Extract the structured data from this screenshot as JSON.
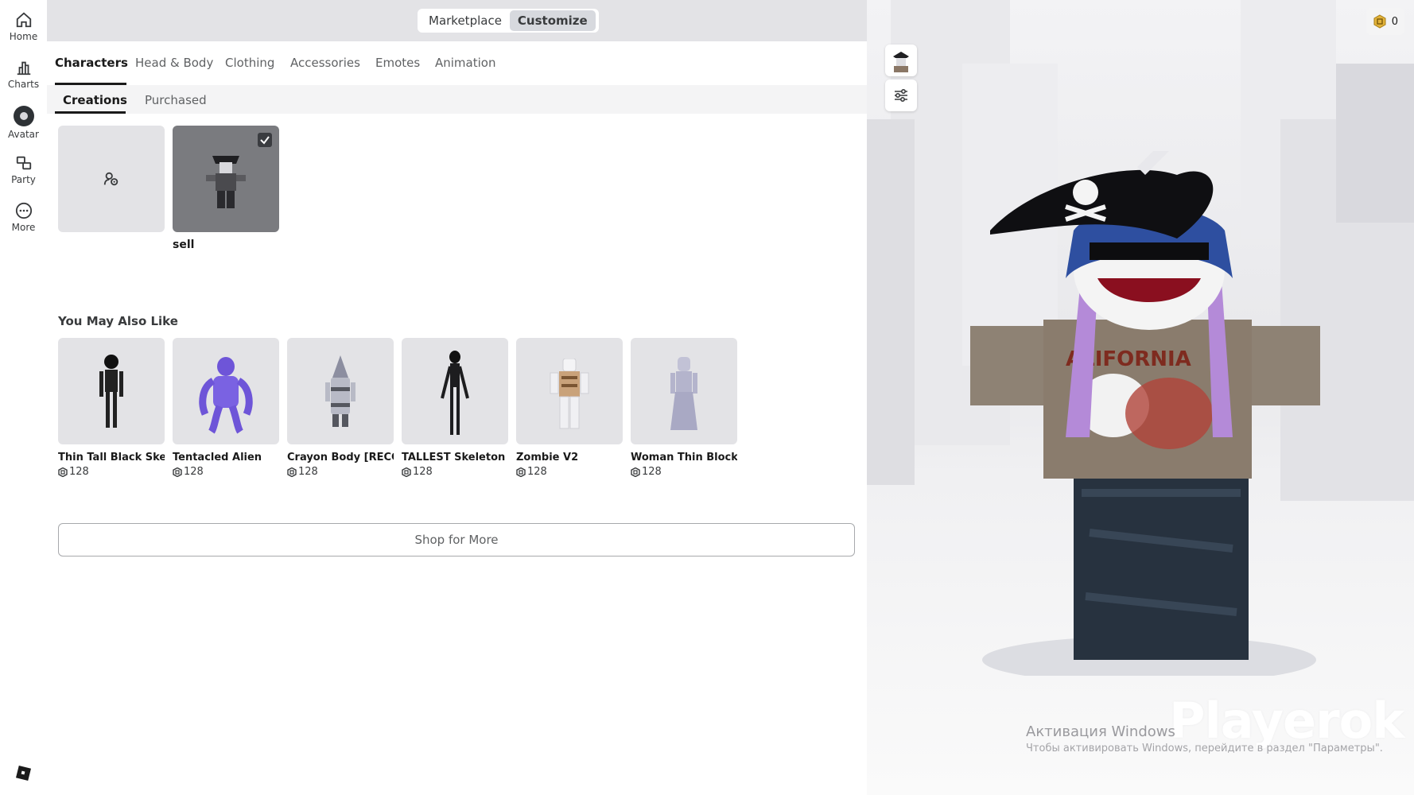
{
  "nav": {
    "items": [
      {
        "label": "Home",
        "icon": "home-icon"
      },
      {
        "label": "Charts",
        "icon": "charts-icon"
      },
      {
        "label": "Avatar",
        "icon": "avatar-icon"
      },
      {
        "label": "Party",
        "icon": "party-icon"
      },
      {
        "label": "More",
        "icon": "more-icon"
      }
    ]
  },
  "topbar": {
    "marketplace": "Marketplace",
    "customize": "Customize"
  },
  "tabs": [
    "Characters",
    "Head & Body",
    "Clothing",
    "Accessories",
    "Emotes",
    "Animation"
  ],
  "subtabs": [
    "Creations",
    "Purchased"
  ],
  "creations": [
    {
      "label": "",
      "type": "create-new"
    },
    {
      "label": "sell",
      "selected": true
    }
  ],
  "recommend": {
    "title": "You May Also Like",
    "items": [
      {
        "name": "Thin Tall Black Skel...",
        "price": "128"
      },
      {
        "name": "Tentacled Alien",
        "price": "128"
      },
      {
        "name": "Crayon Body [RECO...",
        "price": "128"
      },
      {
        "name": "TALLEST Skeleton [...",
        "price": "128"
      },
      {
        "name": "Zombie V2",
        "price": "128"
      },
      {
        "name": "Woman Thin Blocky",
        "price": "128"
      }
    ]
  },
  "shop_button": "Shop for More",
  "preview": {
    "robux_balance": "0",
    "watermark_title": "Активация Windows",
    "watermark_sub": "Чтобы активировать Windows, перейдите в раздел \"Параметры\".",
    "overlay_logo": "Playerok"
  },
  "colors": {
    "accent": "#1a1a1a",
    "panel": "#ffffff",
    "background": "#e3e3e6"
  }
}
